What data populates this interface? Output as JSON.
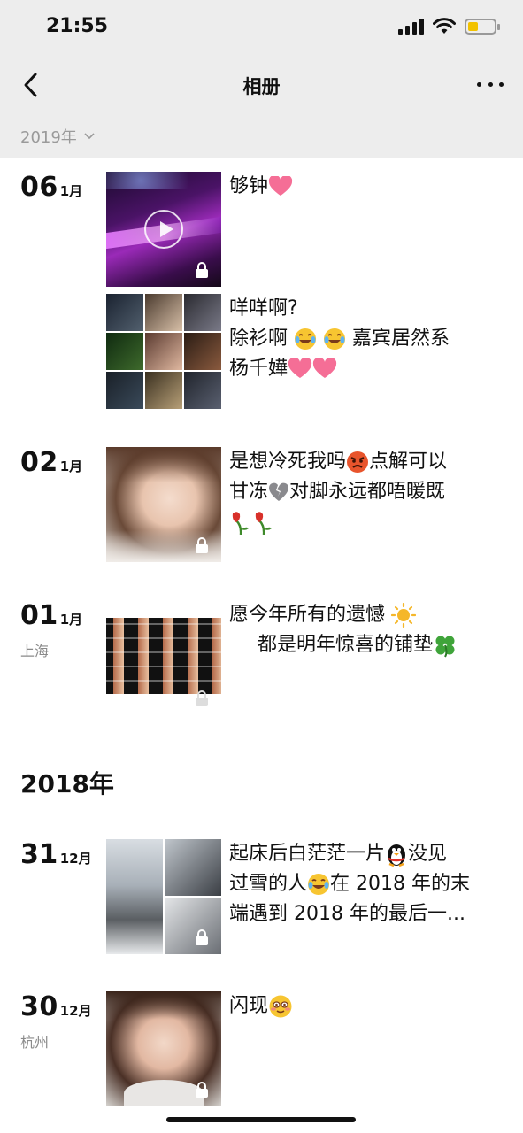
{
  "status": {
    "time": "21:55"
  },
  "nav": {
    "title": "相册"
  },
  "filter": {
    "year_label": "2019年"
  },
  "year_2018_heading": "2018年",
  "entries": [
    {
      "day": "06",
      "month": "1月",
      "location": "",
      "caption_lines": [
        "够钟"
      ],
      "photo_type": "video"
    },
    {
      "day": "",
      "month": "",
      "location": "",
      "caption_lines": [
        "咩咩啊?",
        "除衫啊",
        "嘉宾居然系",
        "杨千嬅"
      ],
      "photo_type": "grid9"
    },
    {
      "day": "02",
      "month": "1月",
      "location": "",
      "caption_lines": [
        "是想冷死我吗",
        "点解可以",
        "甘冻",
        "对脚永远都唔暖既"
      ],
      "photo_type": "single"
    },
    {
      "day": "01",
      "month": "1月",
      "location": "上海",
      "caption_lines": [
        "愿今年所有的遗憾",
        "都是明年惊喜的铺垫"
      ],
      "photo_type": "single"
    },
    {
      "day": "31",
      "month": "12月",
      "location": "",
      "caption_lines": [
        "起床后白茫茫一片",
        "没见",
        "过雪的人",
        "在 2018 年的末",
        "端遇到 2018 年的最后一..."
      ],
      "photo_type": "grid3"
    },
    {
      "day": "30",
      "month": "12月",
      "location": "杭州",
      "caption_lines": [
        "闪现"
      ],
      "photo_type": "single"
    }
  ],
  "icons": {
    "back": "chevron-left-icon",
    "more": "more-dots-icon",
    "lock": "lock-icon",
    "play": "play-icon",
    "dropdown": "chevron-down-icon"
  }
}
